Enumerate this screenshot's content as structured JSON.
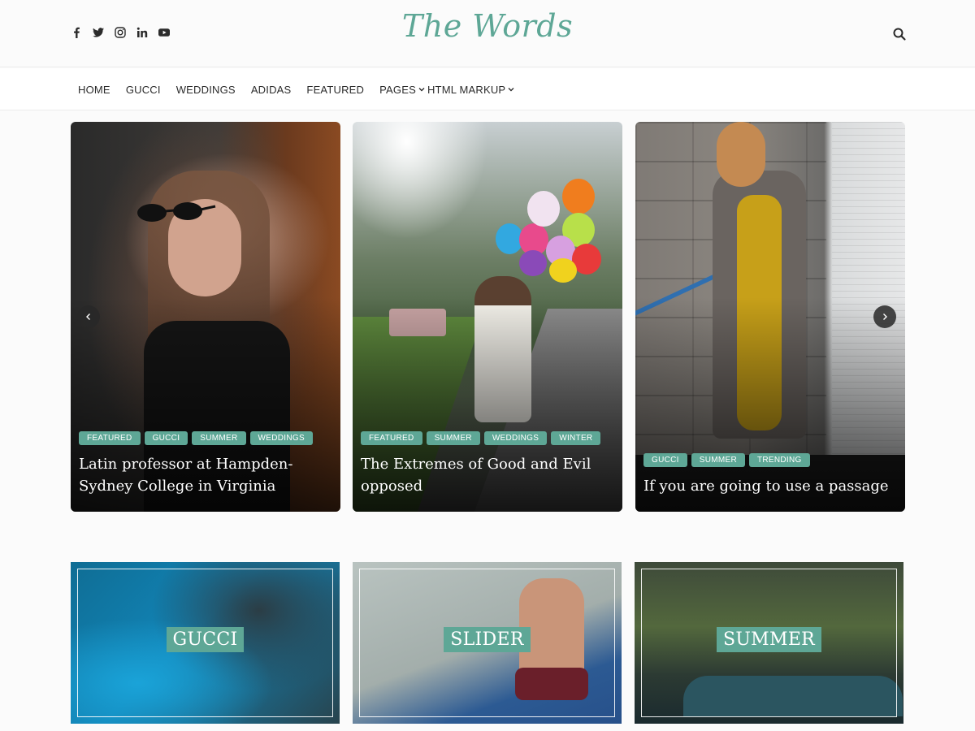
{
  "header": {
    "logo": "The Words",
    "social_icons": [
      "facebook-icon",
      "twitter-icon",
      "instagram-icon",
      "linkedin-icon",
      "youtube-icon"
    ],
    "search_icon": "search-icon"
  },
  "nav": {
    "items": [
      {
        "label": "HOME"
      },
      {
        "label": "GUCCI"
      },
      {
        "label": "WEDDINGS"
      },
      {
        "label": "ADIDAS"
      },
      {
        "label": "FEATURED"
      },
      {
        "label": "PAGES",
        "dropdown": true
      },
      {
        "label": "HTML MARKUP",
        "dropdown": true
      }
    ]
  },
  "slider": {
    "slides": [
      {
        "tags": [
          "FEATURED",
          "GUCCI",
          "SUMMER",
          "WEDDINGS"
        ],
        "title": "Latin professor at Hampden-Sydney College in Virginia"
      },
      {
        "tags": [
          "FEATURED",
          "SUMMER",
          "WEDDINGS",
          "WINTER"
        ],
        "title": "The Extremes of Good and Evil opposed"
      },
      {
        "tags": [
          "GUCCI",
          "SUMMER",
          "TRENDING"
        ],
        "title": "If you are going to use a passage"
      }
    ],
    "prev_icon": "chevron-left-icon",
    "next_icon": "chevron-right-icon"
  },
  "categories": [
    {
      "label": "GUCCI"
    },
    {
      "label": "SLIDER"
    },
    {
      "label": "SUMMER"
    }
  ],
  "colors": {
    "accent": "#5ea796",
    "text": "#2b2b2b",
    "background": "#fbfbfb"
  }
}
